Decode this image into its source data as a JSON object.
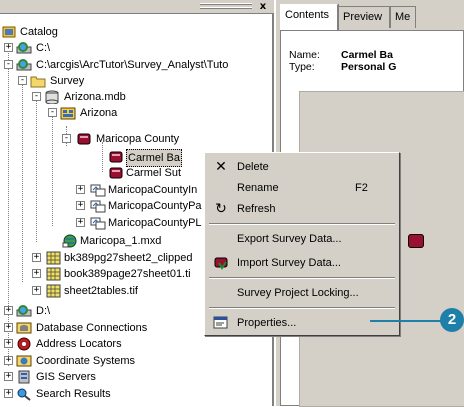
{
  "tree": {
    "header_close": "x",
    "nodes": [
      {
        "label": "Catalog",
        "expander": ""
      },
      {
        "label": "C:\\",
        "expander": "+"
      },
      {
        "label": "C:\\arcgis\\ArcTutor\\Survey_Analyst\\Tuto",
        "expander": "-"
      },
      {
        "label": "Survey",
        "expander": "-"
      },
      {
        "label": "Arizona.mdb",
        "expander": "-"
      },
      {
        "label": "Arizona",
        "expander": "-"
      },
      {
        "label": "Maricopa County",
        "expander": "-"
      },
      {
        "label": "Carmel Ba",
        "expander": ""
      },
      {
        "label": "Carmel Sut",
        "expander": ""
      },
      {
        "label": "MaricopaCountyIn",
        "expander": "+"
      },
      {
        "label": "MaricopaCountyPa",
        "expander": "+"
      },
      {
        "label": "MaricopaCountyPL",
        "expander": "+"
      },
      {
        "label": "Maricopa_1.mxd",
        "expander": ""
      },
      {
        "label": "bk389pg27sheet2_clipped",
        "expander": "+"
      },
      {
        "label": "book389page27sheet01.ti",
        "expander": "+"
      },
      {
        "label": "sheet2tables.tif",
        "expander": "+"
      },
      {
        "label": "D:\\",
        "expander": "+"
      },
      {
        "label": "Database Connections",
        "expander": "+"
      },
      {
        "label": "Address Locators",
        "expander": "+"
      },
      {
        "label": "Coordinate Systems",
        "expander": "+"
      },
      {
        "label": "GIS Servers",
        "expander": "+"
      },
      {
        "label": "Search Results",
        "expander": "+"
      }
    ]
  },
  "right": {
    "tabs": [
      "Contents",
      "Preview",
      "Me"
    ],
    "name_label": "Name:",
    "name_value": "Carmel Ba",
    "type_label": "Type:",
    "type_value": "Personal G"
  },
  "menu": {
    "items": [
      {
        "label": "Delete",
        "shortcut": "",
        "icon": "delete-icon"
      },
      {
        "label": "Rename",
        "shortcut": "F2",
        "icon": ""
      },
      {
        "label": "Refresh",
        "shortcut": "",
        "icon": "refresh-icon"
      },
      {
        "label": "Export Survey Data...",
        "shortcut": "",
        "icon": ""
      },
      {
        "label": "Import Survey Data...",
        "shortcut": "",
        "icon": "import-icon"
      },
      {
        "label": "Survey Project Locking...",
        "shortcut": "",
        "icon": ""
      },
      {
        "label": "Properties...",
        "shortcut": "",
        "icon": "properties-icon"
      }
    ]
  },
  "callout": {
    "number": "2",
    "color": "#1e7fa8"
  },
  "colors": {
    "highlight": "#0a246a",
    "chrome": "#d4d0c8",
    "db_red": "#9a1030"
  }
}
